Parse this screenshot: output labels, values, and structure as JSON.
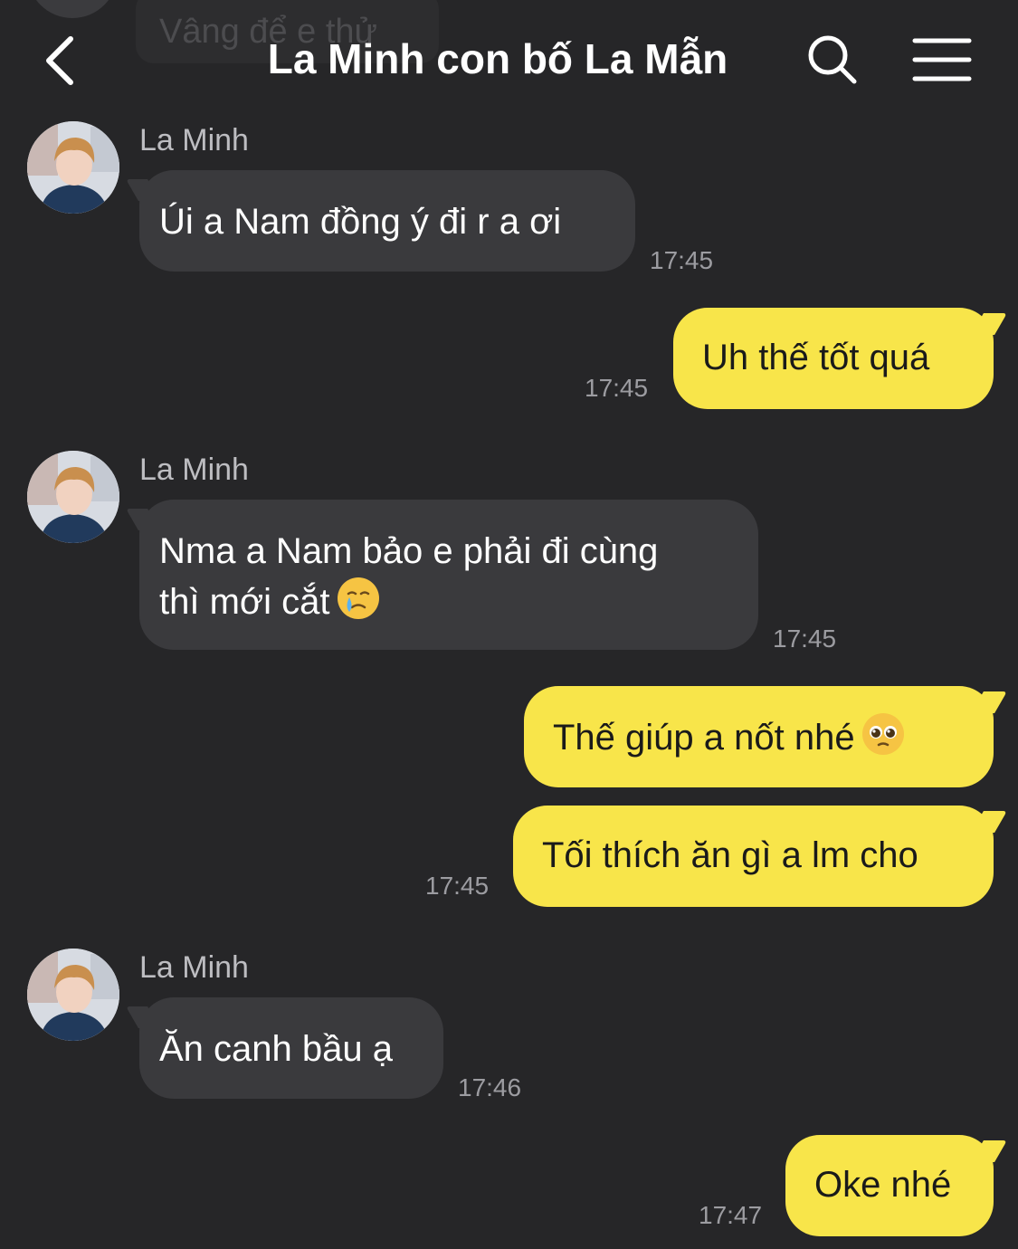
{
  "ghost_message": "Vâng để e thử",
  "header": {
    "title": "La Minh con bố La Mẫn",
    "back_icon": "chevron-left-icon",
    "search_icon": "search-icon",
    "menu_icon": "hamburger-menu-icon"
  },
  "messages": [
    {
      "sender": "La Minh",
      "text": "Úi a Nam đồng ý đi r a ơi",
      "time": "17:45",
      "direction": "in"
    },
    {
      "text": "Uh thế tốt quá",
      "time": "17:45",
      "direction": "out"
    },
    {
      "sender": "La Minh",
      "line1": "Nma a Nam bảo e phải đi cùng",
      "line2": "thì mới cắt",
      "emoji": "crying-face-emoji",
      "time": "17:45",
      "direction": "in"
    },
    {
      "text": "Thế giúp a nốt nhé",
      "emoji": "pleading-face-emoji",
      "direction": "out"
    },
    {
      "text": "Tối thích ăn gì a lm cho",
      "time": "17:45",
      "direction": "out"
    },
    {
      "sender": "La Minh",
      "text": "Ăn canh bầu ạ",
      "time": "17:46",
      "direction": "in"
    },
    {
      "text": "Oke nhé",
      "time": "17:47",
      "direction": "out"
    }
  ],
  "colors": {
    "background": "#262628",
    "incoming_bubble": "#3a3a3d",
    "outgoing_bubble": "#f8e54a",
    "timestamp": "#9c9ca1"
  }
}
